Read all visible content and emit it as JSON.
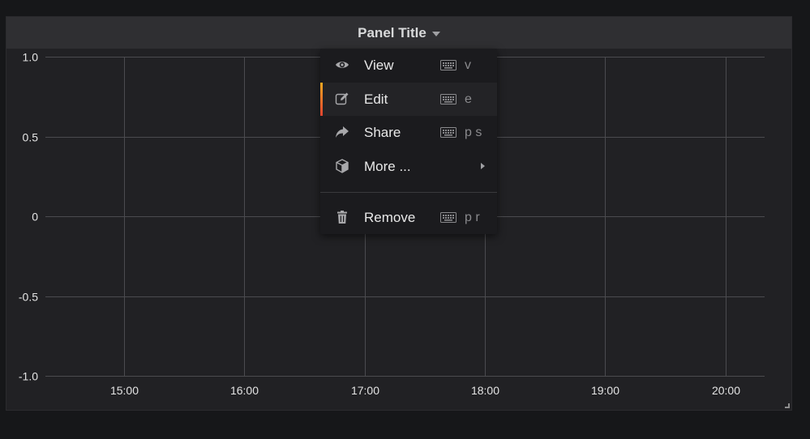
{
  "panel": {
    "title": "Panel Title"
  },
  "chart_data": {
    "type": "line",
    "title": "Panel Title",
    "x_ticks": [
      "15:00",
      "16:00",
      "17:00",
      "18:00",
      "19:00",
      "20:00"
    ],
    "y_ticks": [
      "1.0",
      "0.5",
      "0",
      "-0.5",
      "-1.0"
    ],
    "y_values": [
      1.0,
      0.5,
      0,
      -0.5,
      -1.0
    ],
    "ylim": [
      -1.0,
      1.0
    ],
    "series": [],
    "grid": true,
    "colors": {
      "grid": "#4b4b4f",
      "tick_text": "#e3e3e3"
    }
  },
  "menu": {
    "items": [
      {
        "label": "View",
        "icon": "eye-icon",
        "shortcut": "v"
      },
      {
        "label": "Edit",
        "icon": "edit-icon",
        "shortcut": "e"
      },
      {
        "label": "Share",
        "icon": "share-icon",
        "shortcut": "p s"
      },
      {
        "label": "More ...",
        "icon": "cube-icon",
        "shortcut": ""
      },
      {
        "label": "Remove",
        "icon": "trash-icon",
        "shortcut": "p r"
      }
    ],
    "active_index": 1,
    "accent_colors": [
      "#f6a821",
      "#e0432f"
    ]
  }
}
